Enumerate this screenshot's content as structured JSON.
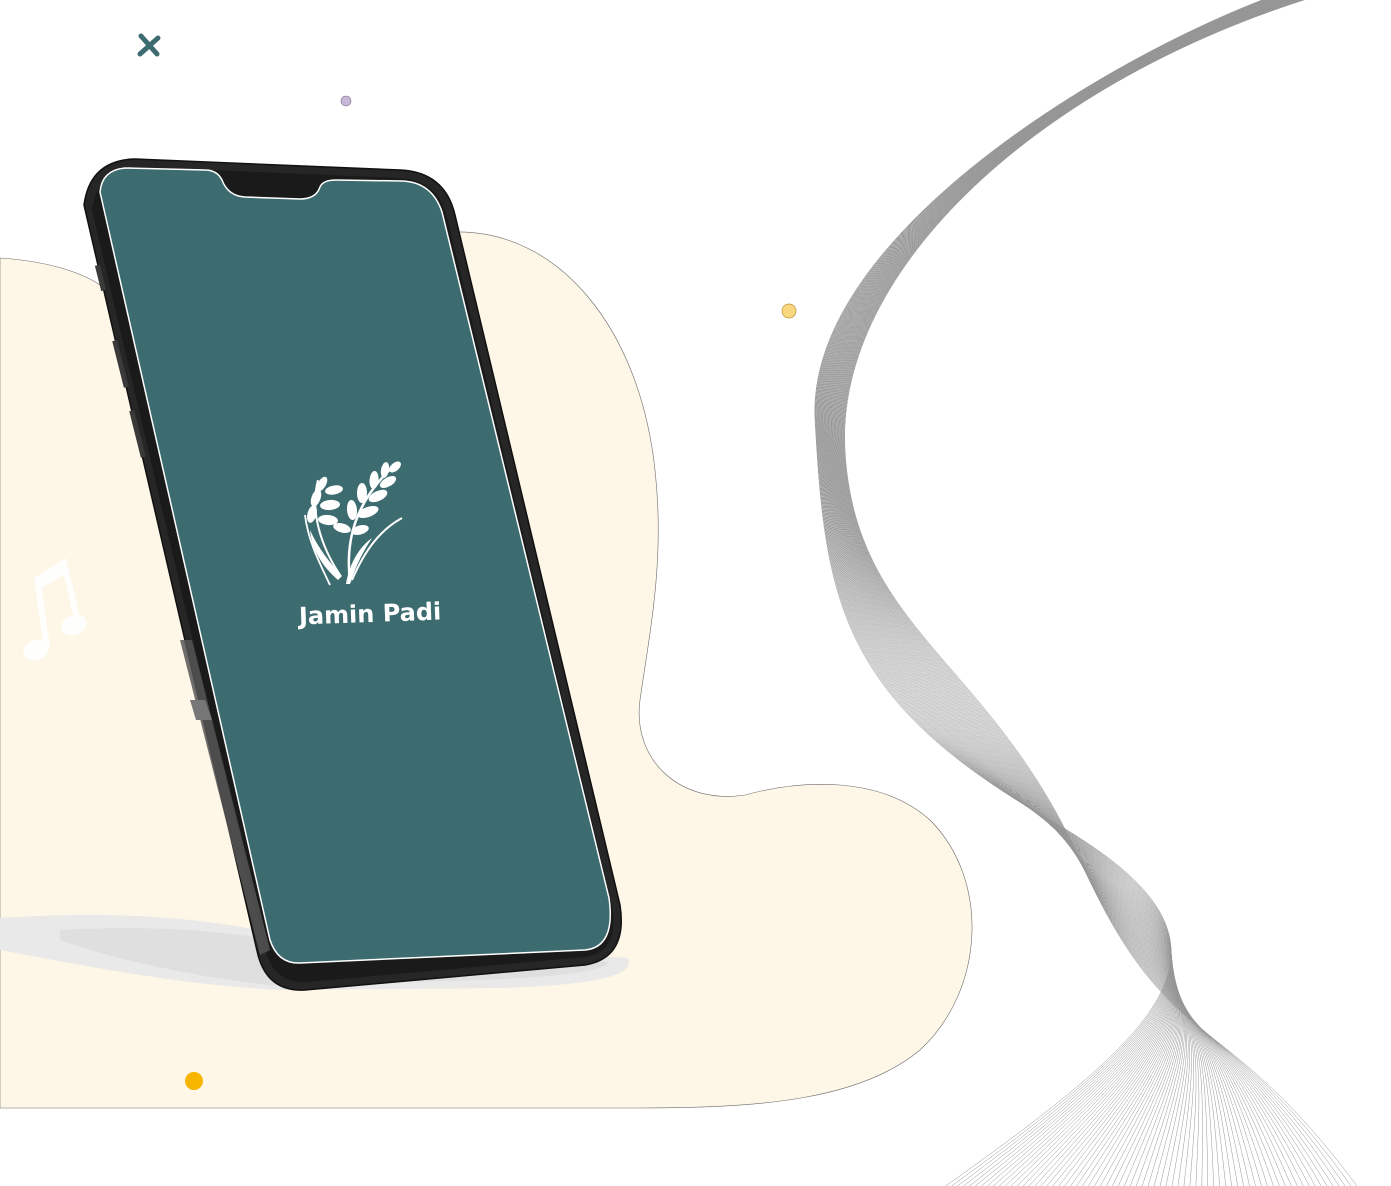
{
  "app": {
    "name": "Jamin Padi"
  },
  "icons": {
    "logo": "rice-stalk-icon",
    "decoration_note": "music-note-icon",
    "decoration_cross": "cross-icon"
  },
  "colors": {
    "screen": "#3d6c70",
    "blob": "#fef7e7",
    "phone_body": "#262626",
    "accent_dot": "#f7b500",
    "small_dot_yellow": "#f9d77e",
    "small_dot_purple": "#c8b8d8",
    "cross": "#3d6c70",
    "wave_lines": "#8a8a8a"
  }
}
